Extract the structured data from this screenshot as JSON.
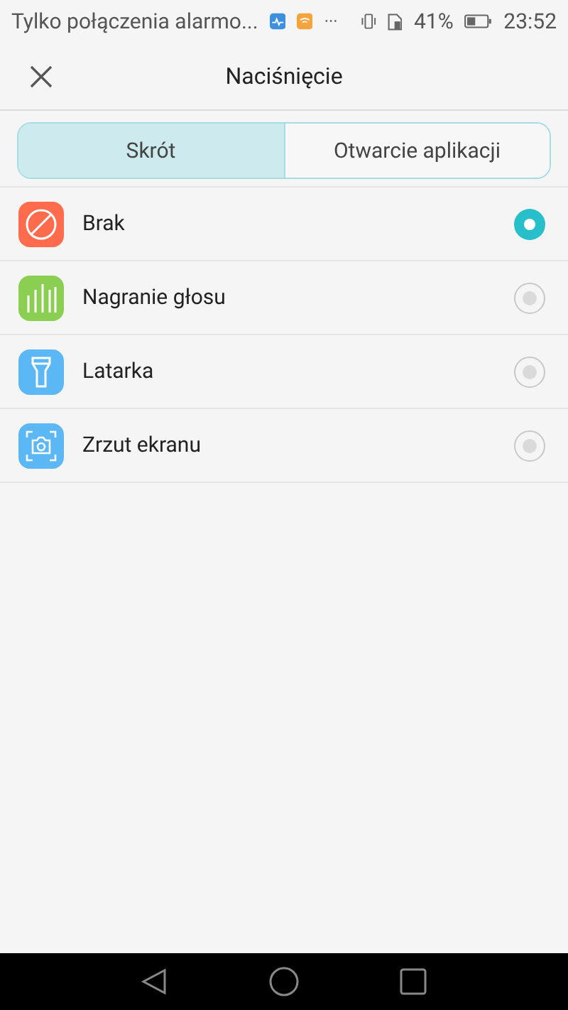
{
  "status_bar": {
    "notification": "Tylko połączenia alarmo...",
    "more": "···",
    "battery_percent": "41%",
    "time": "23:52"
  },
  "header": {
    "title": "Naciśnięcie"
  },
  "tabs": [
    {
      "label": "Skrót",
      "selected": true
    },
    {
      "label": "Otwarcie aplikacji",
      "selected": false
    }
  ],
  "options": [
    {
      "label": "Brak",
      "kind": "none",
      "selected": true
    },
    {
      "label": "Nagranie głosu",
      "kind": "voice",
      "selected": false
    },
    {
      "label": "Latarka",
      "kind": "flashlight",
      "selected": false
    },
    {
      "label": "Zrzut ekranu",
      "kind": "screenshot",
      "selected": false
    }
  ]
}
